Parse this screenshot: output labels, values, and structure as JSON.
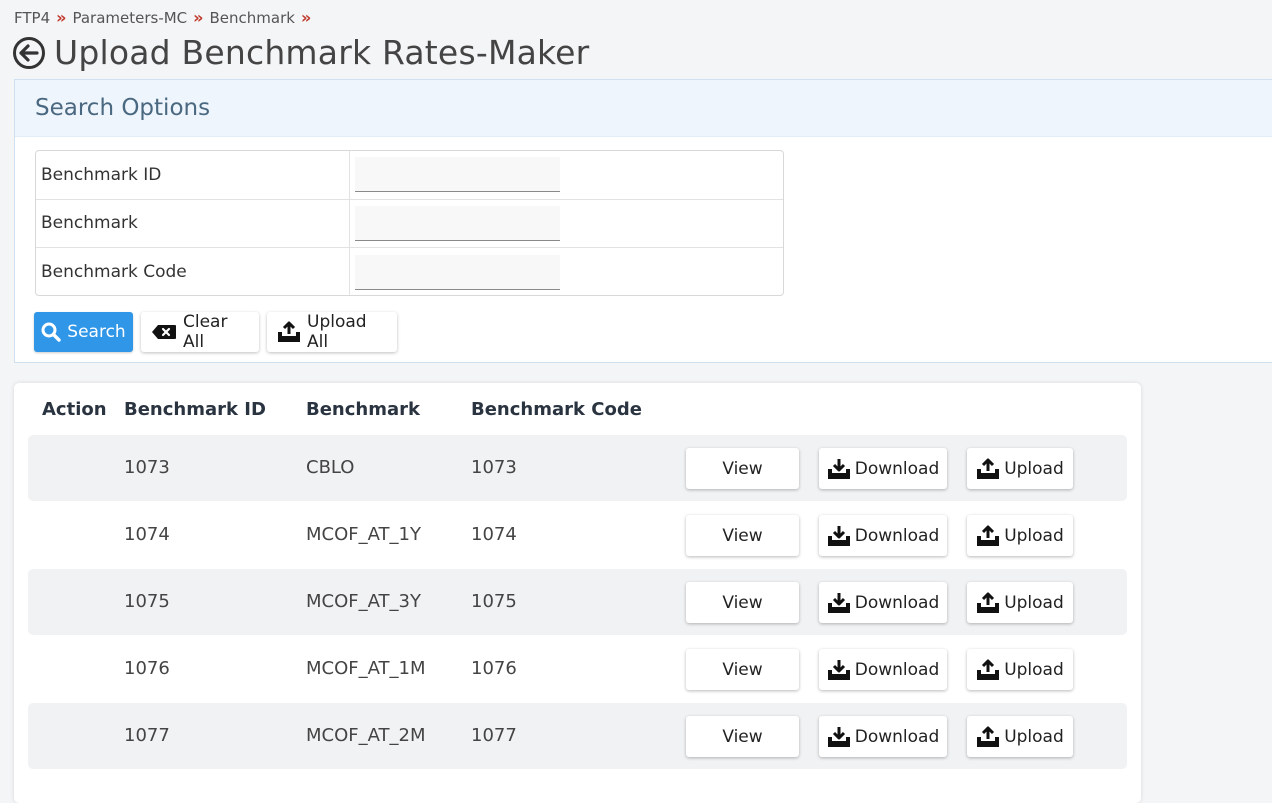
{
  "breadcrumb": [
    "FTP4",
    "Parameters-MC",
    "Benchmark"
  ],
  "breadcrumb_separator": "»",
  "page_title": "Upload Benchmark Rates-Maker",
  "search": {
    "heading": "Search Options",
    "fields": [
      {
        "label": "Benchmark ID",
        "value": ""
      },
      {
        "label": "Benchmark",
        "value": ""
      },
      {
        "label": "Benchmark Code",
        "value": ""
      }
    ],
    "buttons": {
      "search": "Search",
      "clear": "Clear All",
      "upload_all": "Upload All"
    }
  },
  "table": {
    "headers": {
      "action": "Action",
      "id": "Benchmark ID",
      "benchmark": "Benchmark",
      "code": "Benchmark Code"
    },
    "row_buttons": {
      "view": "View",
      "download": "Download",
      "upload": "Upload"
    },
    "rows": [
      {
        "id": "1073",
        "benchmark": "CBLO",
        "code": "1073"
      },
      {
        "id": "1074",
        "benchmark": "MCOF_AT_1Y",
        "code": "1074"
      },
      {
        "id": "1075",
        "benchmark": "MCOF_AT_3Y",
        "code": "1075"
      },
      {
        "id": "1076",
        "benchmark": "MCOF_AT_1M",
        "code": "1076"
      },
      {
        "id": "1077",
        "benchmark": "MCOF_AT_2M",
        "code": "1077"
      }
    ]
  },
  "colors": {
    "primary": "#2f96e8",
    "separator": "#c0392b",
    "panel_head": "#eef5fc"
  }
}
